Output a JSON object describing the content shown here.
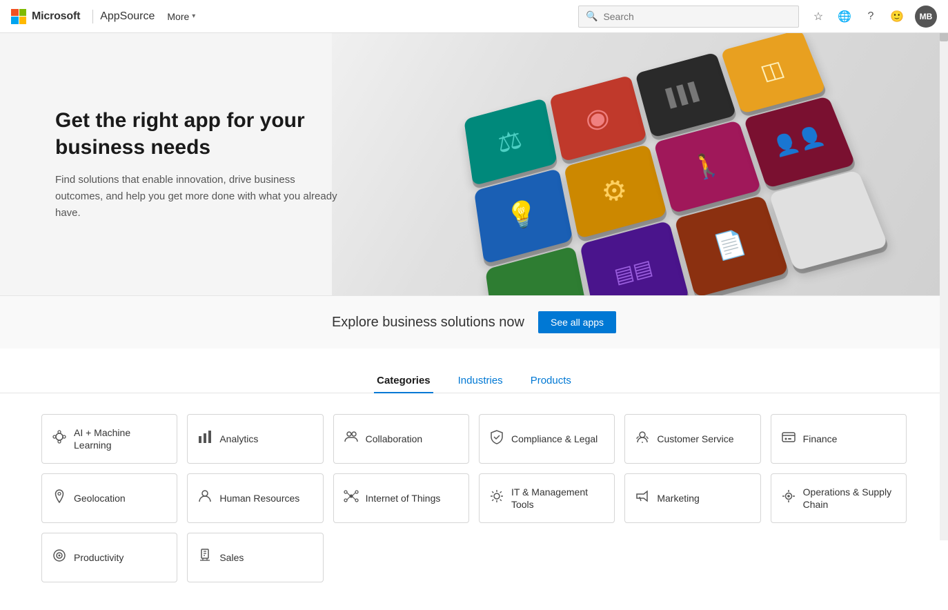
{
  "navbar": {
    "brand": "Microsoft",
    "appsource": "AppSource",
    "more_label": "More",
    "search_placeholder": "Search",
    "avatar_initials": "MB"
  },
  "hero": {
    "title": "Get the right app for your business needs",
    "subtitle": "Find solutions that enable innovation, drive business outcomes, and help you get more done with what you already have."
  },
  "explore": {
    "text": "Explore business solutions now",
    "button": "See all apps"
  },
  "tabs": [
    {
      "id": "categories",
      "label": "Categories",
      "active": true
    },
    {
      "id": "industries",
      "label": "Industries",
      "active": false
    },
    {
      "id": "products",
      "label": "Products",
      "active": false
    }
  ],
  "categories": [
    {
      "id": "ai-ml",
      "icon": "🤖",
      "label": "AI + Machine Learning"
    },
    {
      "id": "analytics",
      "icon": "📊",
      "label": "Analytics"
    },
    {
      "id": "collaboration",
      "icon": "👥",
      "label": "Collaboration"
    },
    {
      "id": "compliance",
      "icon": "⚖️",
      "label": "Compliance & Legal"
    },
    {
      "id": "customer-service",
      "icon": "🧑‍💼",
      "label": "Customer Service"
    },
    {
      "id": "finance",
      "icon": "💳",
      "label": "Finance"
    },
    {
      "id": "geolocation",
      "icon": "📍",
      "label": "Geolocation"
    },
    {
      "id": "hr",
      "icon": "👤",
      "label": "Human Resources"
    },
    {
      "id": "iot",
      "icon": "🔗",
      "label": "Internet of Things"
    },
    {
      "id": "it-mgmt",
      "icon": "🔧",
      "label": "IT & Management Tools"
    },
    {
      "id": "marketing",
      "icon": "📣",
      "label": "Marketing"
    },
    {
      "id": "ops-supply",
      "icon": "⚙️",
      "label": "Operations & Supply Chain"
    },
    {
      "id": "productivity",
      "icon": "🎯",
      "label": "Productivity"
    },
    {
      "id": "sales",
      "icon": "🛍️",
      "label": "Sales"
    }
  ],
  "keys": [
    {
      "color": "teal",
      "icon": "⚖"
    },
    {
      "color": "red-dark",
      "icon": "◉"
    },
    {
      "color": "dark",
      "icon": "▐▐▐"
    },
    {
      "color": "orange-y",
      "icon": "◫"
    },
    {
      "color": "blue",
      "icon": "💡"
    },
    {
      "color": "amber",
      "icon": "⚙"
    },
    {
      "color": "magenta",
      "icon": "🚶"
    },
    {
      "color": "crimson",
      "icon": "👥"
    },
    {
      "color": "green",
      "icon": ""
    },
    {
      "color": "purple",
      "icon": "▤"
    },
    {
      "color": "rust",
      "icon": "📄"
    },
    {
      "color": "empty",
      "icon": ""
    }
  ]
}
